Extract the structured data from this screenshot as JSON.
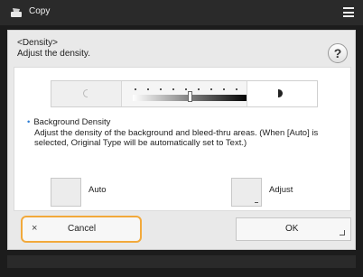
{
  "app": {
    "title": "Copy",
    "icon": "copy-app-icon",
    "menu_icon": "hamburger-menu-icon"
  },
  "dialog": {
    "title": "<Density>",
    "subtitle": "Adjust the density.",
    "help_label": "?"
  },
  "density": {
    "lighter_icon": "half-circle-light-icon",
    "darker_icon": "half-circle-dark-icon",
    "level": 0.5
  },
  "background_density": {
    "title": "Background Density",
    "bullet": "•",
    "description": "Adjust the density of the background and bleed-thru areas. (When [Auto] is selected, Original Type will be automatically set to Text.)"
  },
  "options": {
    "auto_label": "Auto",
    "adjust_label": "Adjust"
  },
  "footer": {
    "cancel_label": "Cancel",
    "cancel_icon": "×",
    "ok_label": "OK"
  },
  "colors": {
    "highlight": "#f2a93b",
    "accent": "#2a7bd4",
    "topbar": "#2a2a2a"
  }
}
